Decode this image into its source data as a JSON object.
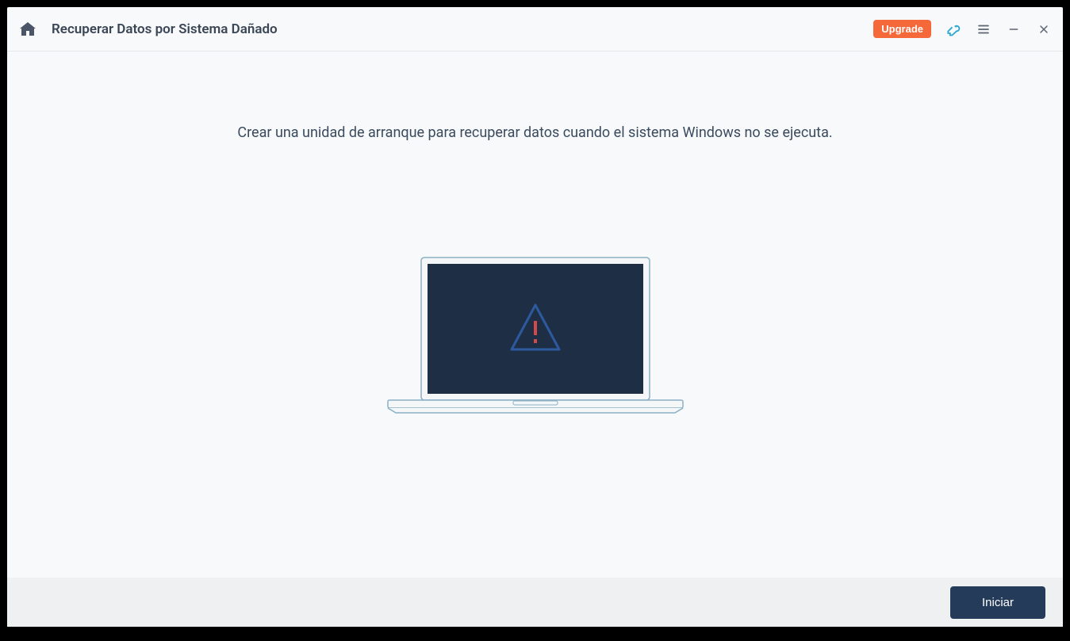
{
  "header": {
    "title": "Recuperar Datos por Sistema Dañado",
    "upgrade_label": "Upgrade"
  },
  "main": {
    "description": "Crear una unidad de arranque para recuperar datos cuando el sistema Windows no se ejecuta."
  },
  "footer": {
    "start_label": "Iniciar"
  }
}
